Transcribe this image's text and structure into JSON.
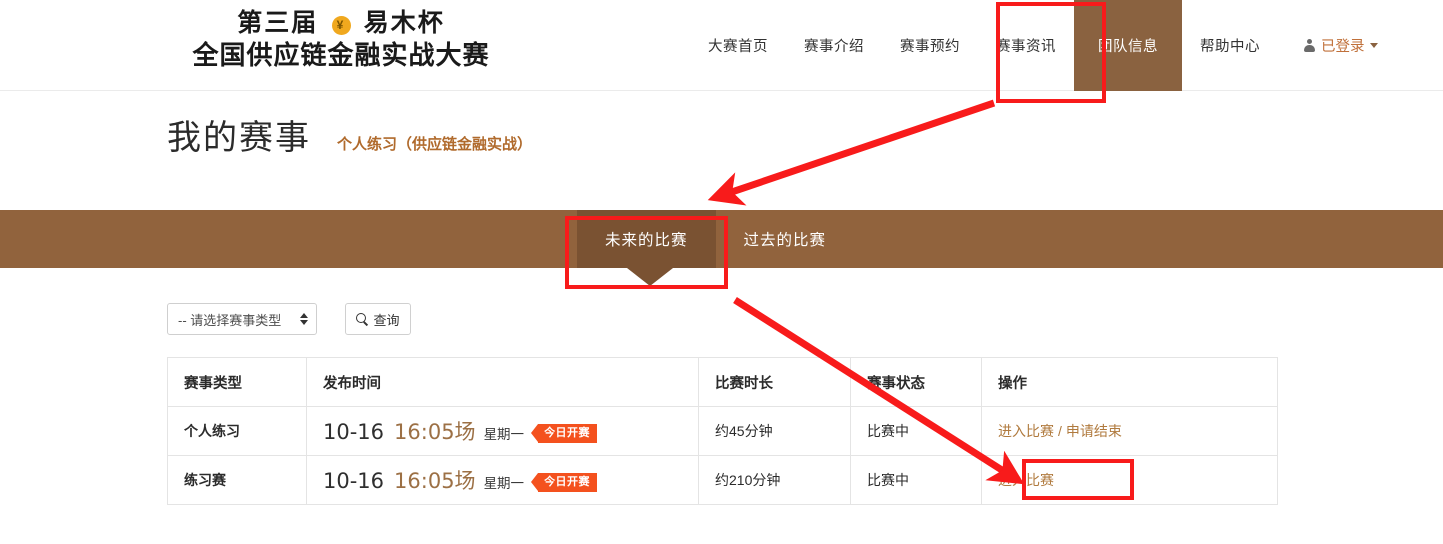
{
  "header": {
    "brand_line1_prefix": "第三届",
    "brand_coin": "¥",
    "brand_line1_suffix": "易木杯",
    "brand_line2": "全国供应链金融实战大赛",
    "nav": [
      {
        "label": "大赛首页",
        "active": false
      },
      {
        "label": "赛事介绍",
        "active": false
      },
      {
        "label": "赛事预约",
        "active": false
      },
      {
        "label": "赛事资讯",
        "active": false
      },
      {
        "label": "团队信息",
        "active": true
      },
      {
        "label": "帮助中心",
        "active": false
      }
    ],
    "user_label": "已登录"
  },
  "page": {
    "title": "我的赛事",
    "subtitle": "个人练习（供应链金融实战）"
  },
  "tabs": [
    {
      "label": "未来的比赛",
      "active": true
    },
    {
      "label": "过去的比赛",
      "active": false
    }
  ],
  "filter": {
    "select_value": "-- 请选择赛事类型",
    "query_label": "查询"
  },
  "table": {
    "headers": [
      "赛事类型",
      "发布时间",
      "比赛时长",
      "赛事状态",
      "操作"
    ],
    "rows": [
      {
        "type": "个人练习",
        "date": "10-16",
        "slot": "16:05场",
        "weekday": "星期一",
        "badge": "今日开赛",
        "duration": "约45分钟",
        "status": "比赛中",
        "op_primary": "进入比赛",
        "op_separator": "/",
        "op_secondary": "申请结束"
      },
      {
        "type": "练习赛",
        "date": "10-16",
        "slot": "16:05场",
        "weekday": "星期一",
        "badge": "今日开赛",
        "duration": "约210分钟",
        "status": "比赛中",
        "op_primary": "进入比赛",
        "op_separator": "",
        "op_secondary": ""
      }
    ]
  },
  "colors": {
    "brand_brown": "#91633d",
    "nav_active_brown": "#8a6240",
    "tab_active_brown": "#7a5232",
    "badge_orange": "#f4511e",
    "link_brown": "#b07a3e",
    "annotation_red": "#f81b1b",
    "coin_gold": "#f0a81e"
  }
}
